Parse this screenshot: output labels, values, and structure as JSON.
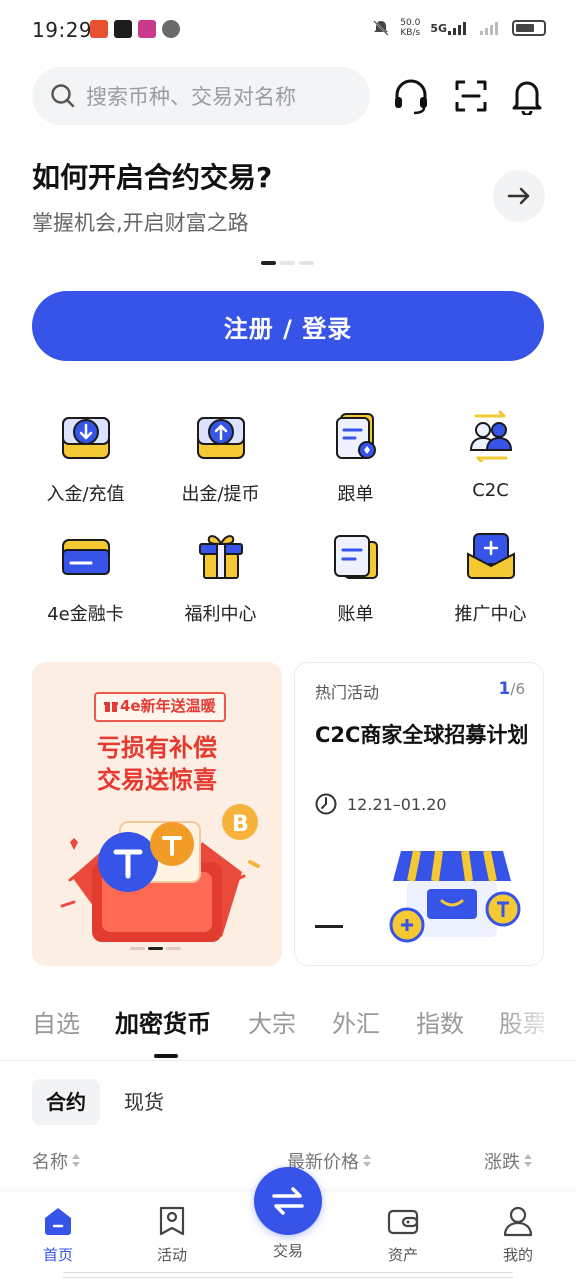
{
  "status_bar": {
    "time": "19:29",
    "speed_value": "50.0",
    "speed_unit": "KB/s",
    "network": "5G"
  },
  "search": {
    "placeholder": "搜索币种、交易对名称"
  },
  "header_icons": [
    "headset-icon",
    "scan-icon",
    "bell-icon"
  ],
  "banner": {
    "title": "如何开启合约交易?",
    "subtitle": "掌握机会,开启财富之路"
  },
  "register_button": "注册 / 登录",
  "quick_actions": [
    {
      "label": "入金/充值",
      "icon": "deposit-icon"
    },
    {
      "label": "出金/提币",
      "icon": "withdraw-icon"
    },
    {
      "label": "跟单",
      "icon": "copy-trade-icon"
    },
    {
      "label": "C2C",
      "icon": "c2c-icon"
    },
    {
      "label": "4e金融卡",
      "icon": "card-icon"
    },
    {
      "label": "福利中心",
      "icon": "gift-icon"
    },
    {
      "label": "账单",
      "icon": "bill-icon"
    },
    {
      "label": "推广中心",
      "icon": "promotion-icon"
    }
  ],
  "promo_left": {
    "tag": "4e新年送温暖",
    "line1": "亏损有补偿",
    "line2": "交易送惊喜"
  },
  "promo_right": {
    "title": "热门活动",
    "page_current": "1",
    "page_total": "/6",
    "headline": "C2C商家全球招募计划",
    "date": "12.21–01.20"
  },
  "market_tabs": [
    "自选",
    "加密货币",
    "大宗",
    "外汇",
    "指数",
    "股票"
  ],
  "market_subtabs": [
    "合约",
    "现货"
  ],
  "columns": {
    "name": "名称",
    "price": "最新价格",
    "change": "涨跌"
  },
  "bottom_nav": [
    {
      "label": "首页",
      "icon": "home-icon"
    },
    {
      "label": "活动",
      "icon": "activity-icon"
    },
    {
      "label": "交易",
      "icon": "trade-icon"
    },
    {
      "label": "资产",
      "icon": "wallet-icon"
    },
    {
      "label": "我的",
      "icon": "profile-icon"
    }
  ],
  "colors": {
    "accent": "#3754e8",
    "yellow": "#f5c933",
    "promo_red": "#e7392f"
  }
}
